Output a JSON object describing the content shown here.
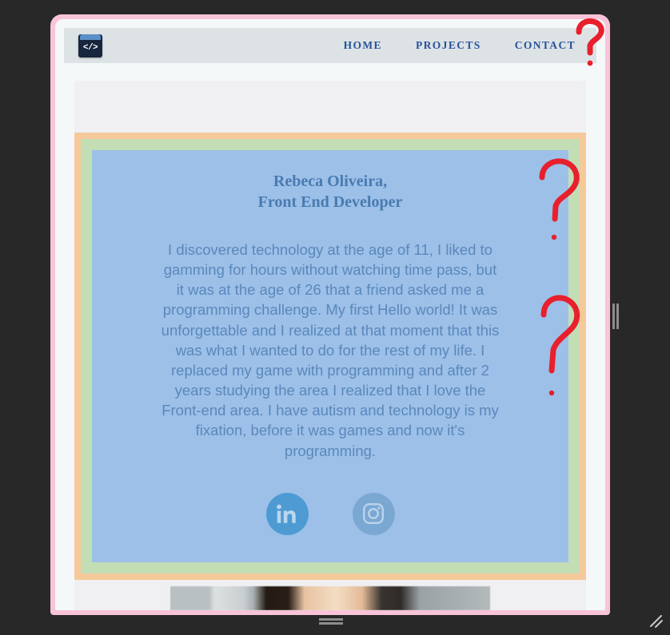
{
  "window": {
    "frame_color": "#f9c3d8",
    "page_background": "#f4f8f9"
  },
  "header": {
    "background": "#dde3e4",
    "logo": {
      "icon": "code-brackets-icon",
      "glyph": "</>",
      "background": "#17263d",
      "accent": "#5b8fc9"
    },
    "nav": {
      "link_color": "#28519c",
      "items": [
        {
          "id": "home",
          "label": "HOME"
        },
        {
          "id": "projects",
          "label": "PROJECTS"
        },
        {
          "id": "contact",
          "label": "CONTACT"
        }
      ]
    }
  },
  "about_card": {
    "outer_border_color": "#f5c99a",
    "middle_border_color": "#c3ddb4",
    "inner_background": "#9cc0e8",
    "heading_color": "#4a7bb0",
    "body_color": "#5b88bb",
    "heading_line_1": "Rebeca Oliveira,",
    "heading_line_2": "Front End Developer",
    "body_text": "I discovered technology at the age of 11, I liked to gamming for hours without watching time pass, but it was at the age of 26 that a friend asked me a programming challenge. My first Hello world! It was unforgettable and I realized at that moment that this was what I wanted to do for the rest of my life. I replaced my game with programming and after 2 years studying the area I realized that I love the Front-end area. I have autism and technology is my fixation, before it was games and now it's programming.",
    "social": [
      {
        "id": "linkedin",
        "icon": "linkedin-icon",
        "label": "in",
        "background": "#4e9bd4",
        "glyph_color": "#b9d8f0"
      },
      {
        "id": "instagram",
        "icon": "instagram-icon",
        "label": "Instagram",
        "background": "#7ba7d3",
        "glyph_color": "#b7d2ea"
      }
    ]
  },
  "profile_photo": {
    "name": "profile-photo",
    "state": "partially visible below fold"
  },
  "annotations": {
    "color": "#e81f2d",
    "marks": [
      {
        "id": "q1",
        "symbol": "?",
        "position": "top-right of window near header"
      },
      {
        "id": "q2",
        "symbol": "?",
        "position": "right side beside about card heading"
      },
      {
        "id": "q3",
        "symbol": "?",
        "position": "right side beside about card body"
      }
    ]
  },
  "resize_handles": [
    {
      "id": "right",
      "name": "resize-handle-right"
    },
    {
      "id": "bottom",
      "name": "resize-handle-bottom"
    },
    {
      "id": "corner",
      "name": "resize-handle-corner"
    }
  ]
}
